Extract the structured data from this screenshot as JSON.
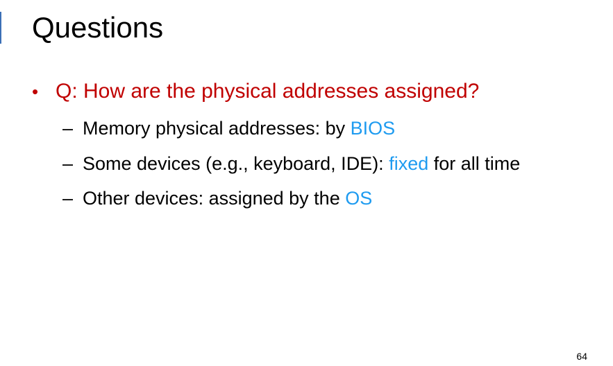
{
  "slide": {
    "title": "Questions",
    "page_number": "64"
  },
  "colors": {
    "question": "#c00000",
    "highlight": "#1e9bf0",
    "text": "#000000",
    "accent_bar": "#3b6fb6"
  },
  "bullet": {
    "marker": "•",
    "text": "Q: How are the physical addresses assigned?"
  },
  "sub_bullets": [
    {
      "marker": "–",
      "prefix": "Memory physical addresses: by ",
      "highlight": "BIOS",
      "suffix": ""
    },
    {
      "marker": "–",
      "prefix": "Some devices (e.g., keyboard, IDE): ",
      "highlight": "fixed",
      "suffix": " for all time"
    },
    {
      "marker": "–",
      "prefix": "Other devices: assigned by the ",
      "highlight": "OS",
      "suffix": ""
    }
  ]
}
